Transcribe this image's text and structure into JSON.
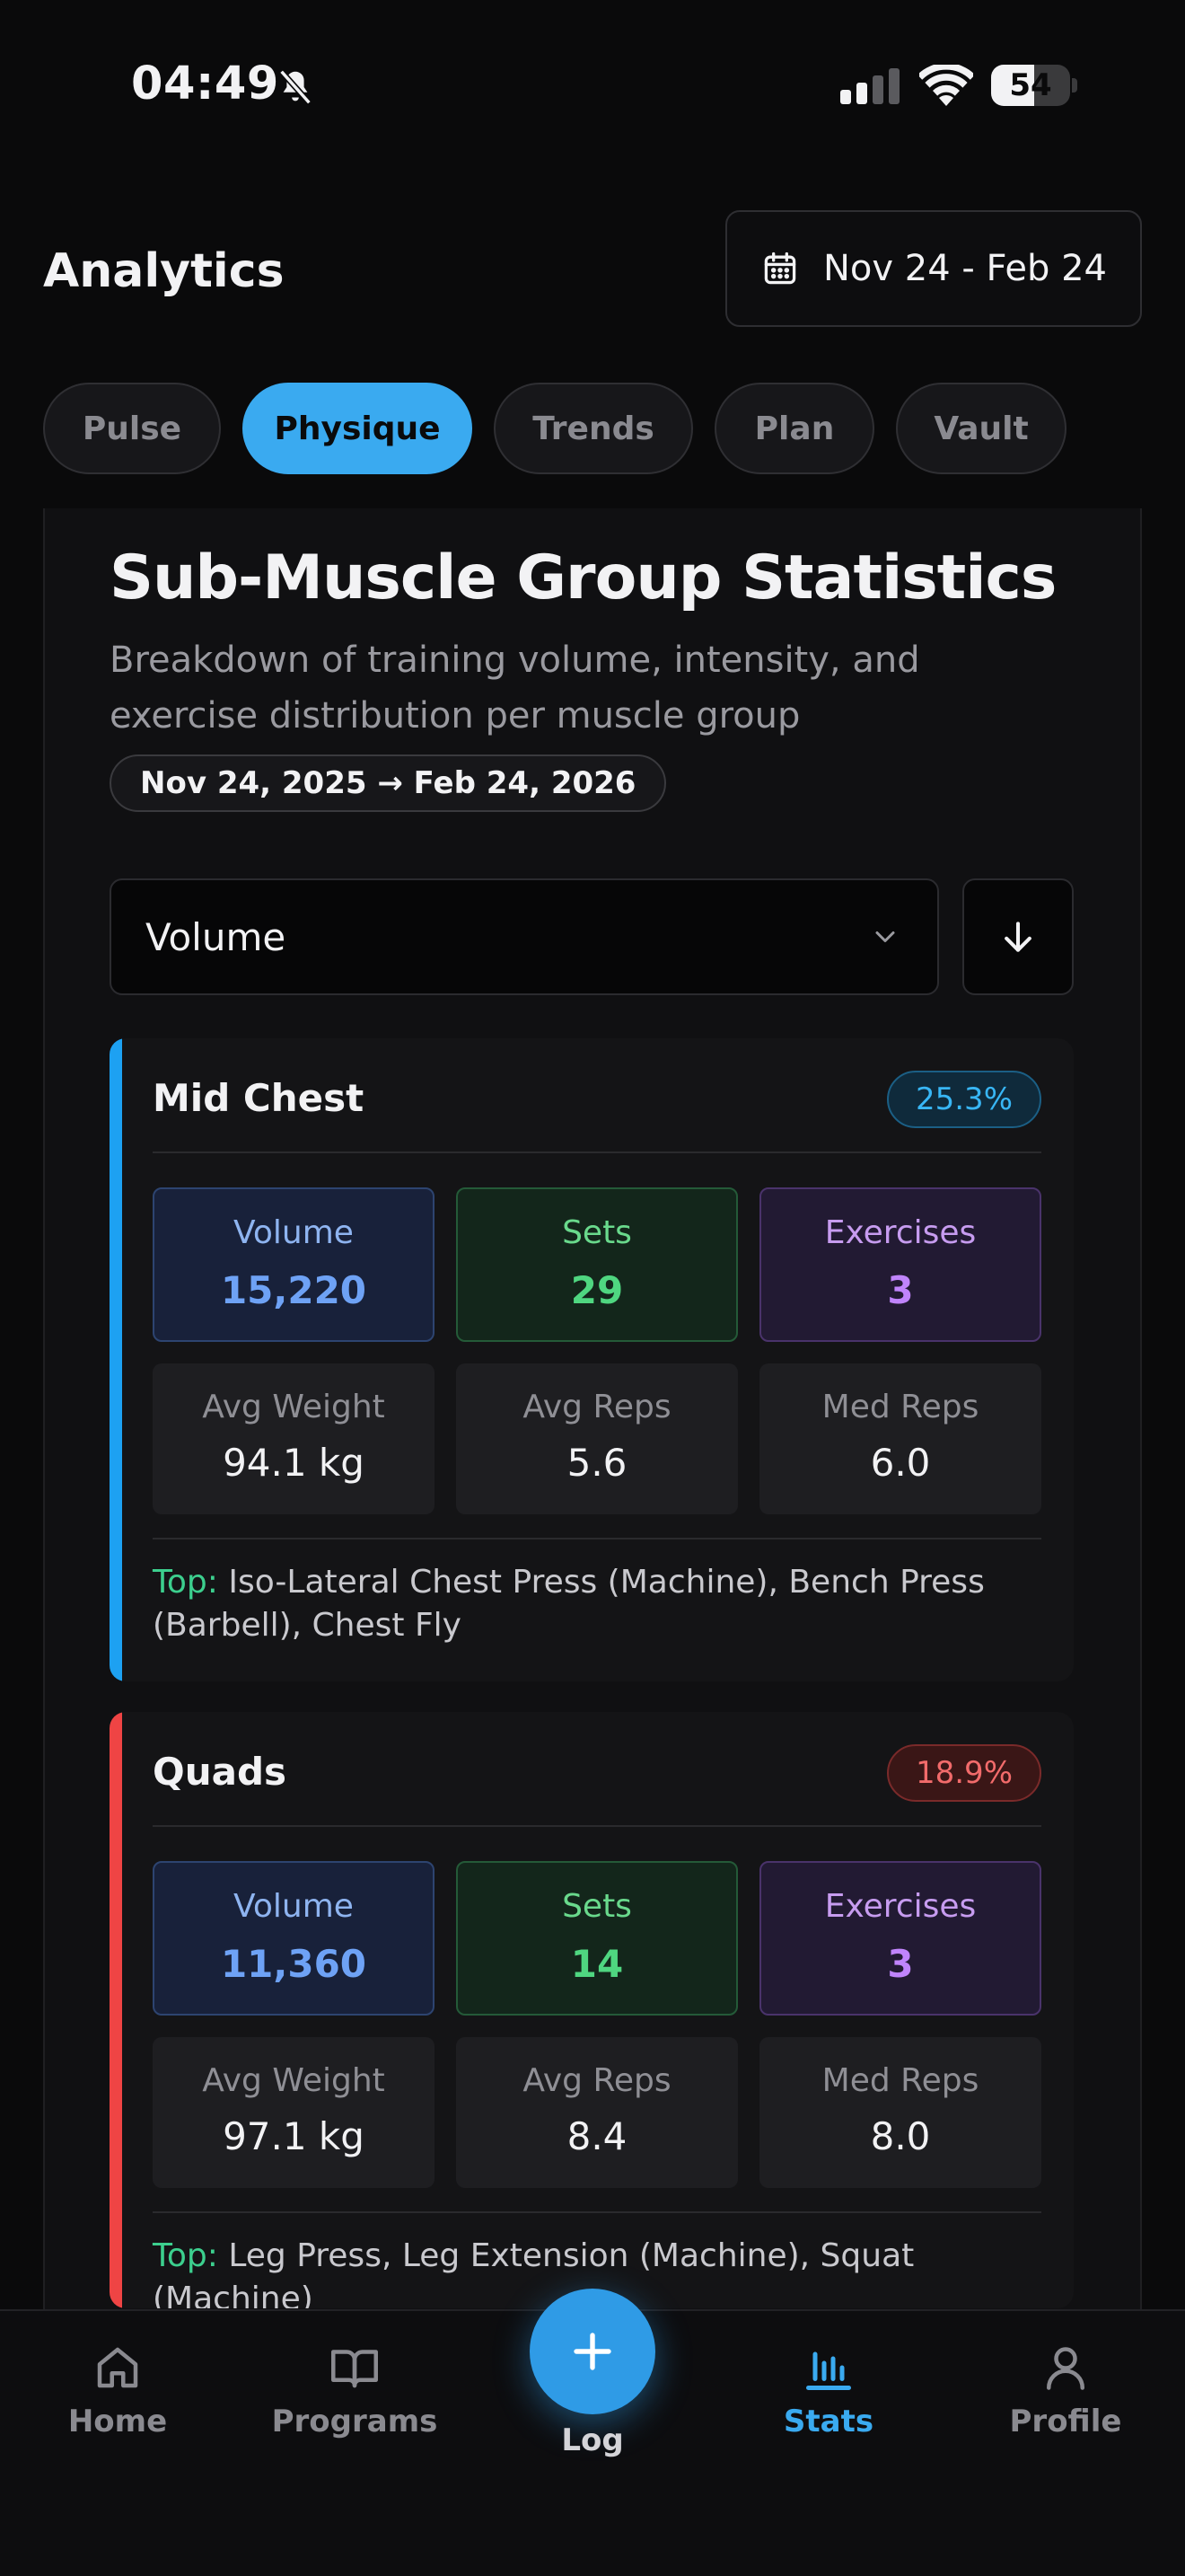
{
  "status_bar": {
    "time": "04:49",
    "battery": "54",
    "battery_level": 0.54
  },
  "header": {
    "title": "Analytics",
    "date_range": "Nov 24 - Feb 24"
  },
  "tabs": [
    {
      "label": "Pulse",
      "active": false
    },
    {
      "label": "Physique",
      "active": true
    },
    {
      "label": "Trends",
      "active": false
    },
    {
      "label": "Plan",
      "active": false
    },
    {
      "label": "Vault",
      "active": false
    }
  ],
  "section": {
    "title": "Sub-Muscle Group Statistics",
    "subtitle": "Breakdown of training volume, intensity, and exercise distribution per muscle group",
    "range": "Nov 24, 2025 → Feb 24, 2026"
  },
  "sort": {
    "selected": "Volume"
  },
  "cards": [
    {
      "name": "Mid Chest",
      "percent": "25.3%",
      "accent": "#1da1f2",
      "volume_label": "Volume",
      "volume": "15,220",
      "sets_label": "Sets",
      "sets": "29",
      "exercises_label": "Exercises",
      "exercises": "3",
      "avg_weight_label": "Avg Weight",
      "avg_weight": "94.1 kg",
      "avg_reps_label": "Avg Reps",
      "avg_reps": "5.6",
      "med_reps_label": "Med Reps",
      "med_reps": "6.0",
      "top_label": "Top:",
      "top": " Iso-Lateral Chest Press (Machine), Bench Press (Barbell), Chest Fly"
    },
    {
      "name": "Quads",
      "percent": "18.9%",
      "accent": "#ef4444",
      "volume_label": "Volume",
      "volume": "11,360",
      "sets_label": "Sets",
      "sets": "14",
      "exercises_label": "Exercises",
      "exercises": "3",
      "avg_weight_label": "Avg Weight",
      "avg_weight": "97.1 kg",
      "avg_reps_label": "Avg Reps",
      "avg_reps": "8.4",
      "med_reps_label": "Med Reps",
      "med_reps": "8.0",
      "top_label": "Top:",
      "top": " Leg Press, Leg Extension (Machine), Squat (Machine)"
    }
  ],
  "nav": {
    "home": "Home",
    "programs": "Programs",
    "log": "Log",
    "stats": "Stats",
    "profile": "Profile",
    "active": "stats"
  }
}
